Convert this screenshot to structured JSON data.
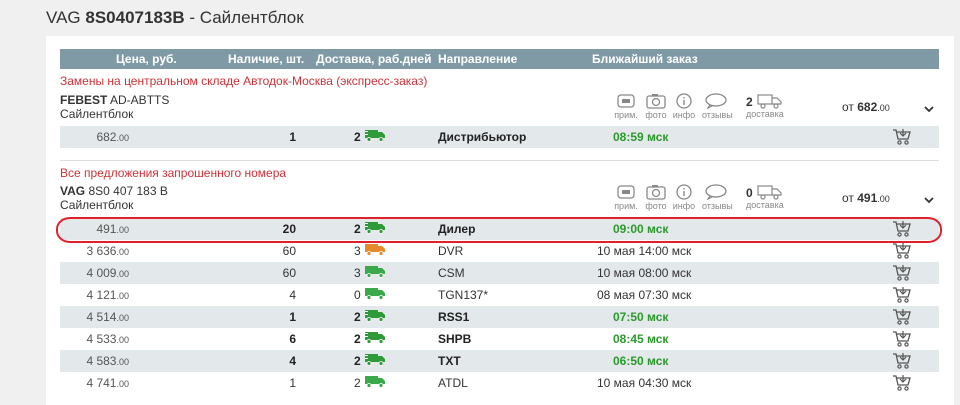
{
  "header": {
    "prefix": "VAG",
    "part_number": "8S0407183B",
    "suffix": " - Сайлентблок"
  },
  "columns": [
    "Цена, руб.",
    "Наличие, шт.",
    "Доставка, раб.дней",
    "Направление",
    "Ближайший заказ"
  ],
  "section1": {
    "title": "Замены на центральном складе Автодок-Москва (экспресс-заказ)",
    "offer": {
      "brand": "FEBEST",
      "code": "AD-ABTTS",
      "desc": "Сайлентблок",
      "delivery_count": "2",
      "from_label": "от",
      "from_price": "682",
      "from_cents": ".00"
    },
    "rows": [
      {
        "price": "682",
        "cents": ".00",
        "qty": "1",
        "days": "2",
        "direction": "Дистрибьютор",
        "nearest": "08:59 мск",
        "green": true,
        "bold": true,
        "truck": "green-dark"
      }
    ]
  },
  "section2": {
    "title": "Все предложения запрошенного номера",
    "offer": {
      "brand": "VAG",
      "code": "8S0 407 183 B",
      "desc": "Сайлентблок",
      "delivery_count": "0",
      "from_label": "от",
      "from_price": "491",
      "from_cents": ".00"
    },
    "rows": [
      {
        "price": "491",
        "cents": ".00",
        "qty": "20",
        "days": "2",
        "direction": "Дилер",
        "nearest": "09:00 мск",
        "green": true,
        "bold": true,
        "truck": "green-dark"
      },
      {
        "price": "3 636",
        "cents": ".00",
        "qty": "60",
        "days": "3",
        "direction": "DVR",
        "nearest": "10 мая 14:00 мск",
        "green": false,
        "bold": false,
        "truck": "orange"
      },
      {
        "price": "4 009",
        "cents": ".00",
        "qty": "60",
        "days": "3",
        "direction": "CSM",
        "nearest": "10 мая 08:00 мск",
        "green": false,
        "bold": false,
        "truck": "green"
      },
      {
        "price": "4 121",
        "cents": ".00",
        "qty": "4",
        "days": "0",
        "direction": "TGN137*",
        "nearest": "08 мая 07:30 мск",
        "green": false,
        "bold": false,
        "truck": "green"
      },
      {
        "price": "4 514",
        "cents": ".00",
        "qty": "1",
        "days": "2",
        "direction": "RSS1",
        "nearest": "07:50 мск",
        "green": true,
        "bold": true,
        "truck": "green-dark"
      },
      {
        "price": "4 533",
        "cents": ".00",
        "qty": "6",
        "days": "2",
        "direction": "SHPB",
        "nearest": "08:45 мск",
        "green": true,
        "bold": true,
        "truck": "green-dark"
      },
      {
        "price": "4 583",
        "cents": ".00",
        "qty": "4",
        "days": "2",
        "direction": "TXT",
        "nearest": "06:50 мск",
        "green": true,
        "bold": true,
        "truck": "green-dark"
      },
      {
        "price": "4 741",
        "cents": ".00",
        "qty": "1",
        "days": "2",
        "direction": "ATDL",
        "nearest": "10 мая 04:30 мск",
        "green": false,
        "bold": false,
        "truck": "green"
      }
    ]
  },
  "icons": {
    "note": "прим.",
    "photo": "фото",
    "info": "инфо",
    "reviews": "отзывы",
    "delivery": "доставка"
  },
  "colors": {
    "header_bg": "#7f9aa5",
    "section_title": "#c8343a",
    "green": "#2a9a2a",
    "orange": "#e58a2b",
    "highlight": "#e0212b",
    "alt_row": "#e3e8eb"
  }
}
